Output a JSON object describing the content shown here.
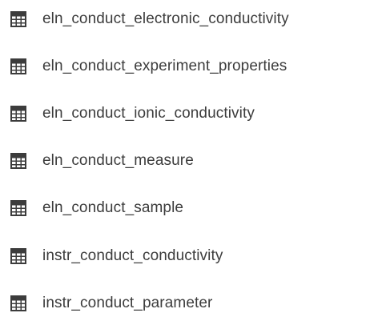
{
  "tables": {
    "items": [
      {
        "label": "eln_conduct_electronic_conductivity",
        "icon": "table-icon"
      },
      {
        "label": "eln_conduct_experiment_properties",
        "icon": "table-icon"
      },
      {
        "label": "eln_conduct_ionic_conductivity",
        "icon": "table-icon"
      },
      {
        "label": "eln_conduct_measure",
        "icon": "table-icon"
      },
      {
        "label": "eln_conduct_sample",
        "icon": "table-icon"
      },
      {
        "label": "instr_conduct_conductivity",
        "icon": "table-icon"
      },
      {
        "label": "instr_conduct_parameter",
        "icon": "table-icon"
      }
    ]
  },
  "colors": {
    "icon": "#3c3c3c",
    "text": "#3c3c3c"
  }
}
